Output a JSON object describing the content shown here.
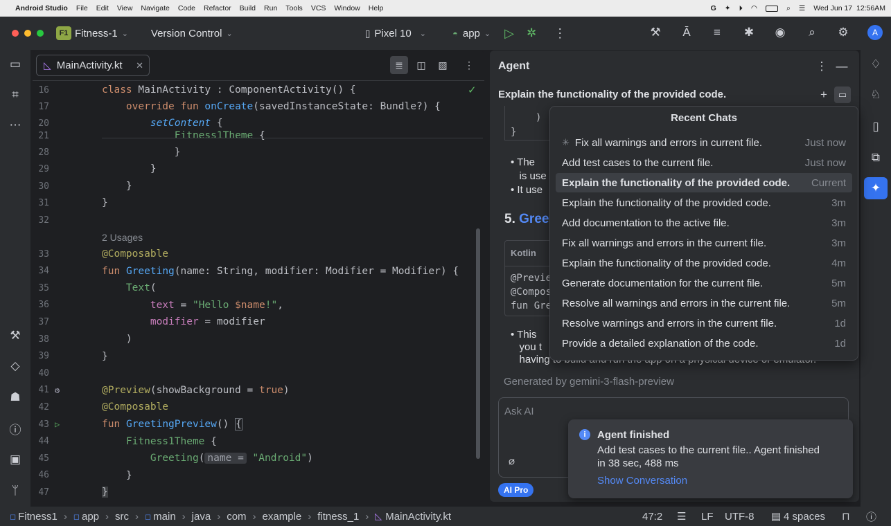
{
  "menubar": {
    "app_name": "Android Studio",
    "items": [
      "File",
      "Edit",
      "View",
      "Navigate",
      "Code",
      "Refactor",
      "Build",
      "Run",
      "Tools",
      "VCS",
      "Window",
      "Help"
    ],
    "datetime": "Wed Jun 17  12:56AM"
  },
  "toolbar": {
    "project_badge": "F1",
    "project_name": "Fitness-1",
    "vcs": "Version Control",
    "device": "Pixel 10",
    "run_config": "app",
    "avatar": "A"
  },
  "editor": {
    "tab_label": "MainActivity.kt",
    "usages_hint": "2 Usages",
    "param_hint": "name =",
    "lines": [
      {
        "n": "16",
        "html": "<span class='k'>class</span> MainActivity : ComponentActivity() {"
      },
      {
        "n": "17",
        "html": "    <span class='k'>override fun</span> <span class='f'>onCreate</span>(savedInstanceState: Bundle?) {"
      },
      {
        "n": "20",
        "html": "        <span class='f' style='font-style:italic'>setContent</span> {"
      },
      {
        "n": "21",
        "html": "            <span class='s'>Fitness1Theme</span> {"
      },
      {
        "n": "28",
        "html": "            }"
      },
      {
        "n": "29",
        "html": "        }"
      },
      {
        "n": "30",
        "html": "    }"
      },
      {
        "n": "31",
        "html": "}"
      },
      {
        "n": "32",
        "html": ""
      },
      {
        "n": "33",
        "html": "<span class='a'>@Composable</span>"
      },
      {
        "n": "34",
        "html": "<span class='k'>fun</span> <span class='f'>Greeting</span>(name: String, modifier: Modifier = Modifier) {"
      },
      {
        "n": "35",
        "html": "    <span class='s'>Text</span>("
      },
      {
        "n": "36",
        "html": "        <span class='p'>text</span> = <span class='s'>\"Hello </span><span class='k'>$name</span><span class='s'>!\"</span>,"
      },
      {
        "n": "37",
        "html": "        <span class='p'>modifier</span> = modifier"
      },
      {
        "n": "38",
        "html": "    )"
      },
      {
        "n": "39",
        "html": "}"
      },
      {
        "n": "40",
        "html": ""
      },
      {
        "n": "41",
        "html": "<span class='a'>@Preview</span>(showBackground = <span class='k'>true</span>)"
      },
      {
        "n": "42",
        "html": "<span class='a'>@Composable</span>"
      },
      {
        "n": "43",
        "html": "<span class='k'>fun</span> <span class='f'>GreetingPreview</span>() <span style='border:1px solid #6f737a'>{</span>"
      },
      {
        "n": "44",
        "html": "    <span class='s'>Fitness1Theme</span> {"
      },
      {
        "n": "45",
        "html": "        <span class='s'>Greeting</span>(<span class='hint'>name =</span> <span class='s'>\"Android\"</span>)"
      },
      {
        "n": "46",
        "html": "    }"
      },
      {
        "n": "47",
        "html": "<span style='background:#3d3f42'>}</span>"
      }
    ]
  },
  "agent": {
    "title": "Agent",
    "subtitle": "Explain the functionality of the provided code.",
    "code_close_paren": ")",
    "code_close_brace": "}",
    "bullet1_a": "The",
    "bullet1_b": "is use",
    "bullet2": "It use",
    "section_num": "5.",
    "section_title": "Gree",
    "code_lang": "Kotlin",
    "code_l1": "@Previe",
    "code_l2": "@Compos",
    "code_l3": "fun Gre",
    "bullet3_a": "This",
    "bullet3_b": "you t",
    "bullet3_c": "having to build and run the app on a physical device or emulator.",
    "generated_by": "Generated by gemini-3-flash-preview",
    "input_placeholder": "Ask AI",
    "badge": "AI Pro"
  },
  "recent_chats": {
    "title": "Recent Chats",
    "items": [
      {
        "label": "Fix all warnings and errors in current file.",
        "time": "Just now"
      },
      {
        "label": "Add test cases to the current file.",
        "time": "Just now"
      },
      {
        "label": "Explain the functionality of the provided code.",
        "time": "Current"
      },
      {
        "label": "Explain the functionality of the provided code.",
        "time": "3m"
      },
      {
        "label": "Add documentation to the active file.",
        "time": "3m"
      },
      {
        "label": "Fix all warnings and errors in the current file.",
        "time": "3m"
      },
      {
        "label": "Explain the functionality of the provided code.",
        "time": "4m"
      },
      {
        "label": "Generate documentation for the current file.",
        "time": "5m"
      },
      {
        "label": "Resolve all warnings and errors in the current file.",
        "time": "5m"
      },
      {
        "label": "Resolve warnings and errors in the current file.",
        "time": "1d"
      },
      {
        "label": "Provide a detailed explanation of the code.",
        "time": "1d"
      }
    ]
  },
  "toast": {
    "title": "Agent finished",
    "body": "Add test cases to the current file.. Agent finished in 38 sec, 488 ms",
    "link": "Show Conversation"
  },
  "statusbar": {
    "crumbs": [
      "Fitness1",
      "app",
      "src",
      "main",
      "java",
      "com",
      "example",
      "fitness_1",
      "MainActivity.kt"
    ],
    "position": "47:2",
    "line_sep": "LF",
    "encoding": "UTF-8",
    "indent": "4 spaces"
  },
  "colors": {
    "accent": "#3573f0",
    "project_badge": "#8ea745"
  }
}
